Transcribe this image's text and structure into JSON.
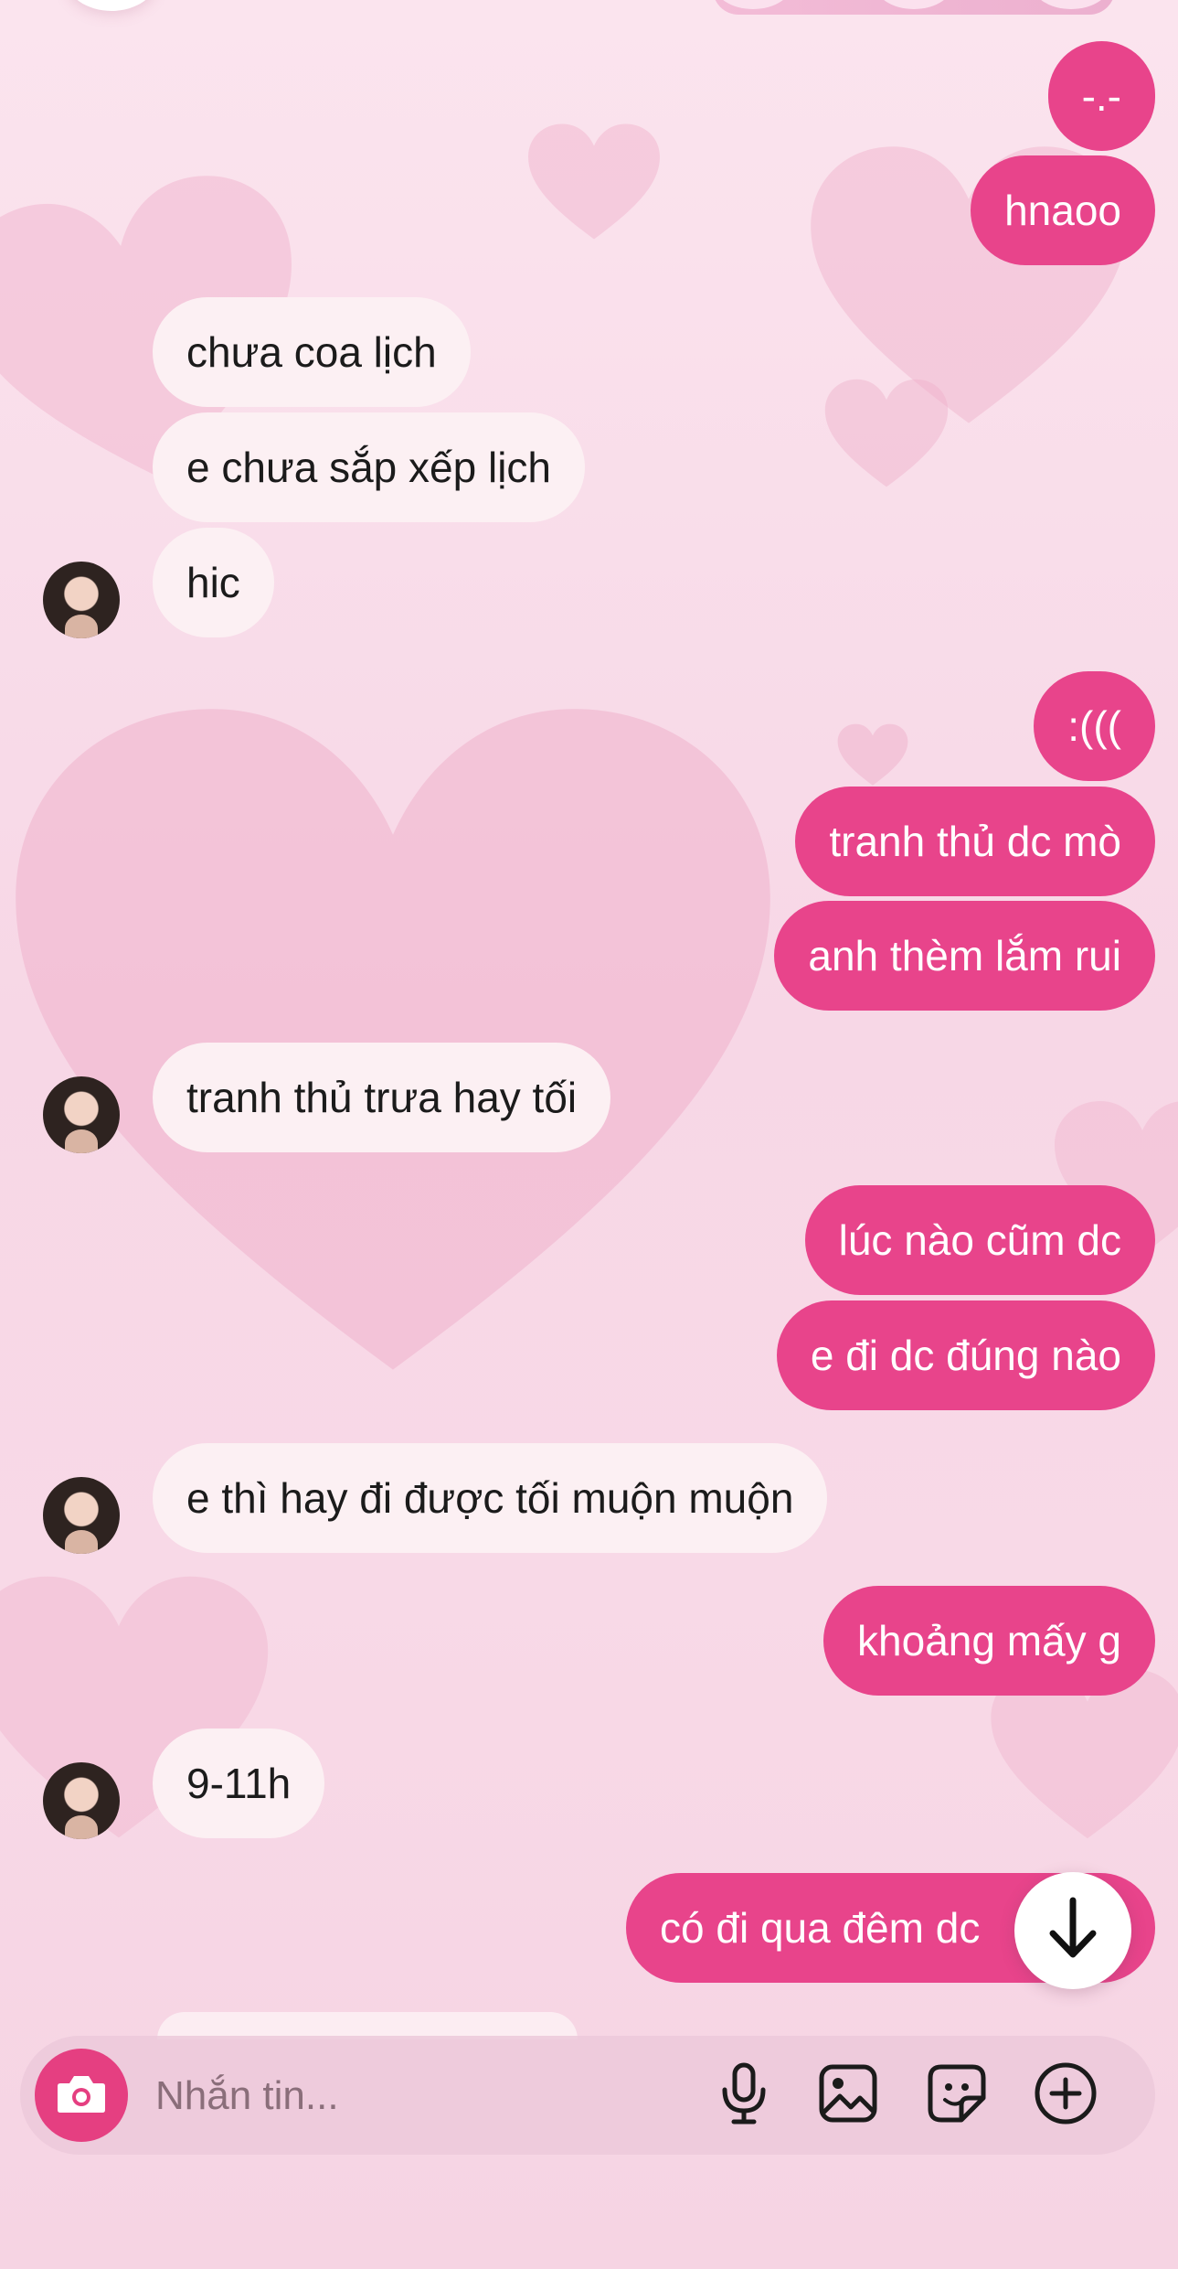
{
  "conversation": {
    "messages": [
      {
        "side": "out",
        "text": "-.-"
      },
      {
        "side": "out",
        "text": "hnaoo"
      },
      {
        "side": "in",
        "text": "chưa coa lịch"
      },
      {
        "side": "in",
        "text": "e chưa sắp xếp lịch"
      },
      {
        "side": "in",
        "text": "hic"
      },
      {
        "side": "out",
        "text": ":((("
      },
      {
        "side": "out",
        "text": "tranh thủ dc mò"
      },
      {
        "side": "out",
        "text": "anh thèm lắm rui"
      },
      {
        "side": "in",
        "text": "tranh thủ trưa hay tối"
      },
      {
        "side": "out",
        "text": "lúc nào cũm dc"
      },
      {
        "side": "out",
        "text": "e đi dc đúng nào"
      },
      {
        "side": "in",
        "text": "e thì hay đi được tối muộn muộn"
      },
      {
        "side": "out",
        "text": "khoảng mấy g"
      },
      {
        "side": "in",
        "text": "9-11h"
      },
      {
        "side": "out",
        "text": "có đi qua đêm dc"
      }
    ]
  },
  "composer": {
    "placeholder": "Nhắn tin...",
    "icons": [
      "camera-icon",
      "microphone-icon",
      "image-icon",
      "sticker-icon",
      "plus-circle-icon"
    ]
  },
  "icons": {
    "scroll_down": "arrow-down-icon"
  },
  "colors": {
    "outgoing_bubble": "#e8448b",
    "incoming_bubble": "#fcf0f3",
    "accent": "#e53f81"
  }
}
